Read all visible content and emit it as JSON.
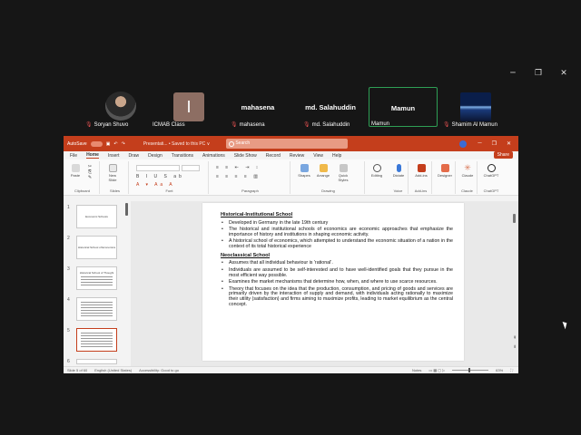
{
  "participants": [
    {
      "name": "Soryan Shuvo",
      "kind": "photo",
      "muted": true
    },
    {
      "name": "ICMAB Class",
      "kind": "letter",
      "letter": "I",
      "muted": false
    },
    {
      "name": "mahasena",
      "kind": "name",
      "muted": true
    },
    {
      "name": "md. Salahuddin",
      "kind": "name",
      "muted": true
    },
    {
      "name": "Mamun",
      "kind": "name",
      "muted": false,
      "active": true
    },
    {
      "name": "Shamim Al Mamun",
      "kind": "earth",
      "muted": true
    }
  ],
  "titlebar": {
    "autosave": "AutoSave",
    "filename": "Presentati... • Saved to this PC ∨",
    "search_placeholder": "Search"
  },
  "tabs": [
    "File",
    "Home",
    "Insert",
    "Draw",
    "Design",
    "Transitions",
    "Animations",
    "Slide Show",
    "Record",
    "Review",
    "View",
    "Help"
  ],
  "active_tab": "Home",
  "share_label": "Share",
  "ribbon_groups": [
    "Clipboard",
    "Slides",
    "Font",
    "Paragraph",
    "Drawing",
    "Voice",
    "Add-ins",
    "Claude",
    "ChatGPT"
  ],
  "ribbon_buttons": {
    "paste": "Paste",
    "new_slide": "New Slide",
    "shapes": "Shapes",
    "arrange": "Arrange",
    "quick_styles": "Quick Styles",
    "editing": "Editing",
    "dictate": "Dictate",
    "add_ins": "Add-ins",
    "designer": "Designer",
    "claude": "Claude",
    "chatgpt": "ChatGPT"
  },
  "thumbnails": [
    {
      "num": "1",
      "title": "Economic Schools"
    },
    {
      "num": "2",
      "title": "Historical School of Economics"
    },
    {
      "num": "3",
      "title": "Historical School of Thought"
    },
    {
      "num": "4",
      "title": ""
    },
    {
      "num": "5",
      "title": "",
      "selected": true
    },
    {
      "num": "6",
      "title": ""
    }
  ],
  "slide": {
    "heading1": "Historical-Institutional School",
    "bullets1": [
      "Developed in Germany in the late 19th century",
      "The historical and institutional schools of economics are economic approaches that emphasize the importance of history and institutions in shaping economic activity.",
      "A historical school of economics, which attempted to understand the economic situation of a nation in the context of its total historical experience"
    ],
    "heading2": "Neoclassical School",
    "bullets2": [
      "Assumes that all individual behaviour is 'rational'.",
      "Individuals are assumed to be self-interested and to have well-identified goals that they pursue in the most efficient way possible.",
      "Examines the market mechanisms that determine how, when, and where to use scarce resources.",
      "Theory that focuses on the idea that the production, consumption, and pricing of goods and services are primarily driven by the interaction of supply and demand, with individuals acting rationally to maximize their utility (satisfaction) and firms aiming to maximize profits, leading to market equilibrium as the central concept."
    ]
  },
  "status": {
    "slide_info": "Slide 5 of 60",
    "language": "English (United States)",
    "accessibility": "Accessibility: Good to go",
    "notes": "Notes",
    "zoom": "63%"
  },
  "colors": {
    "accent": "#c43e1c",
    "meeting_bg": "#161616",
    "active_border": "#2e9f55"
  }
}
